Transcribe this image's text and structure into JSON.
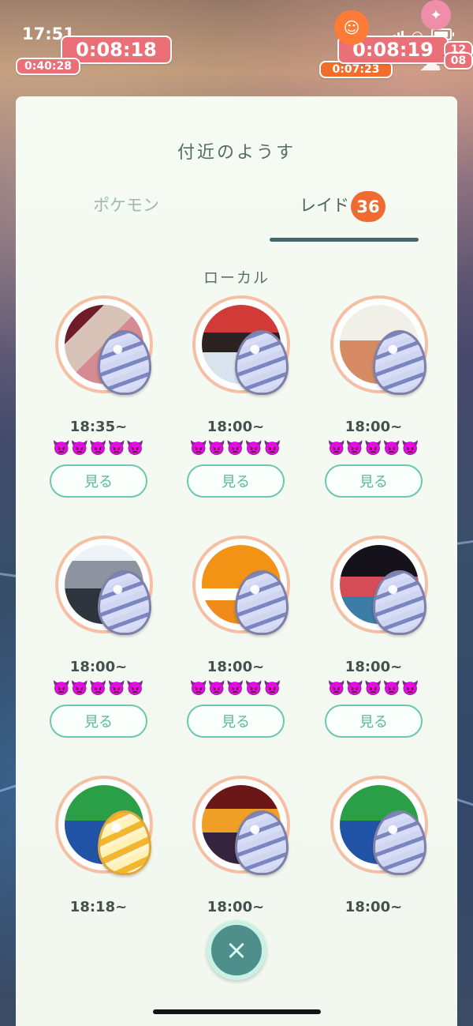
{
  "status_bar": {
    "time": "17:51"
  },
  "map_overlays": {
    "timer_top_left_large": "0:08:18",
    "timer_top_left_small": "0:40:28",
    "timer_top_right_large": "0:08:19",
    "timer_top_right_small": "0:07:23",
    "timer_far_right_partial": "12",
    "timer_far_right_partial_2": "08"
  },
  "panel": {
    "title": "付近のようす",
    "tabs": [
      {
        "label": "ポケモン"
      },
      {
        "label": "レイド",
        "count": "36"
      }
    ],
    "section_title": "ローカル",
    "view_label": "見る",
    "difficulty_icons": "👿👿👿👿👿",
    "raids": [
      {
        "time": "18:35~",
        "egg": "purple"
      },
      {
        "time": "18:00~",
        "egg": "purple"
      },
      {
        "time": "18:00~",
        "egg": "purple"
      },
      {
        "time": "18:00~",
        "egg": "purple"
      },
      {
        "time": "18:00~",
        "egg": "purple"
      },
      {
        "time": "18:00~",
        "egg": "purple"
      },
      {
        "time": "18:18~",
        "egg": "yellow"
      },
      {
        "time": "18:00~",
        "egg": "purple"
      },
      {
        "time": "18:00~",
        "egg": "purple"
      }
    ]
  },
  "colors": {
    "accent": "#69c8ae",
    "tab_badge": "#f06b32",
    "timer": "#ea6f77"
  }
}
